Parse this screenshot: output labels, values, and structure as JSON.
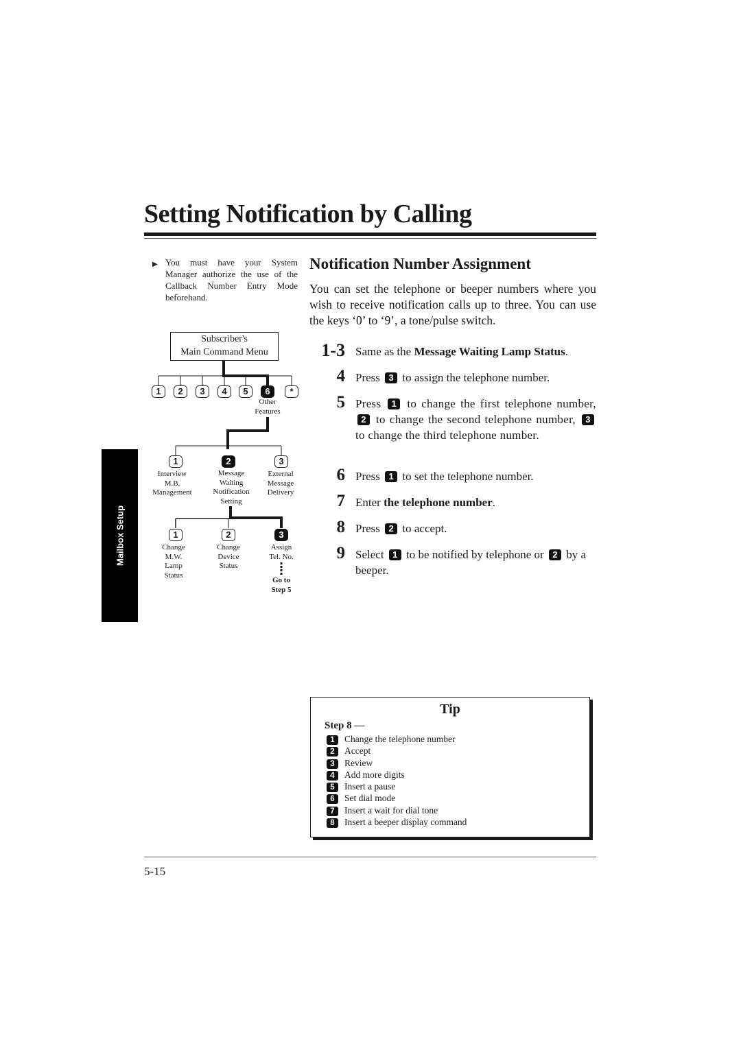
{
  "page": {
    "title": "Setting Notification by Calling",
    "section_tab": "Mailbox Setup",
    "page_number": "5-15"
  },
  "note": {
    "icon": "triangle-right-icon",
    "text": "You must have your System Manager authorize the use of the Callback Number Entry Mode beforehand."
  },
  "diagram": {
    "root": {
      "line1": "Subscriber's",
      "line2": "Main Command Menu"
    },
    "level1_keys": [
      "1",
      "2",
      "3",
      "4",
      "5",
      "6",
      "*"
    ],
    "level1_selected": "6",
    "level1_selected_label": [
      "Other",
      "Features"
    ],
    "level2": [
      {
        "key": "1",
        "label": [
          "Interview",
          "M.B.",
          "Management"
        ]
      },
      {
        "key": "2",
        "label": [
          "Message",
          "Waiting",
          "Notification",
          "Setting"
        ],
        "selected": true
      },
      {
        "key": "3",
        "label": [
          "External",
          "Message",
          "Delivery"
        ]
      }
    ],
    "level3": [
      {
        "key": "1",
        "label": [
          "Change",
          "M.W.",
          "Lamp",
          "Status"
        ]
      },
      {
        "key": "2",
        "label": [
          "Change",
          "Device",
          "Status"
        ]
      },
      {
        "key": "3",
        "label": [
          "Assign",
          "Tel. No."
        ],
        "selected": true
      }
    ],
    "goto": [
      "Go to",
      "Step 5"
    ]
  },
  "section": {
    "heading": "Notification Number Assignment",
    "intro": "You can set the telephone or beeper numbers where you wish to receive notification calls up to three. You can use the keys ‘0’ to ‘9’, a tone/pulse switch."
  },
  "steps": [
    {
      "num": "1-3",
      "pre": "Same as the ",
      "bold": "Message Waiting Lamp Status",
      "post": "."
    },
    {
      "num": "4",
      "a": "Press",
      "k1": "3",
      "b": "to assign the telephone number."
    },
    {
      "num": "5",
      "a": "Press",
      "k1": "1",
      "b": "to change the first telephone number,",
      "k2": "2",
      "c": "to change the second telephone number,",
      "k3": "3",
      "d": "to change the third telephone number."
    },
    {
      "num": "6",
      "a": "Press",
      "k1": "1",
      "b": "to set the telephone number."
    },
    {
      "num": "7",
      "pre": "Enter ",
      "bold": "the telephone number",
      "post": "."
    },
    {
      "num": "8",
      "a": "Press",
      "k1": "2",
      "b": "to accept."
    },
    {
      "num": "9",
      "a": "Select",
      "k1": "1",
      "b": "to be notified by telephone or",
      "k2": "2",
      "c": "by a beeper."
    }
  ],
  "tip": {
    "title": "Tip",
    "step_label": "Step 8 —",
    "items": [
      {
        "key": "1",
        "text": "Change the telephone number"
      },
      {
        "key": "2",
        "text": "Accept"
      },
      {
        "key": "3",
        "text": "Review"
      },
      {
        "key": "4",
        "text": "Add more digits"
      },
      {
        "key": "5",
        "text": "Insert a pause"
      },
      {
        "key": "6",
        "text": "Set dial mode"
      },
      {
        "key": "7",
        "text": "Insert a wait for dial tone"
      },
      {
        "key": "8",
        "text": "Insert a beeper display command"
      }
    ]
  }
}
